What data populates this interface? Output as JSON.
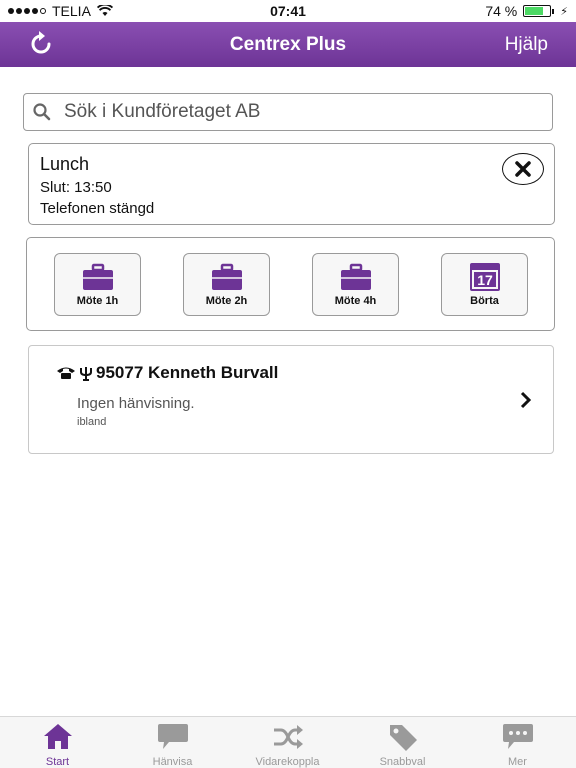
{
  "status_bar": {
    "carrier": "TELIA",
    "time": "07:41",
    "battery": "74 %",
    "battery_level": 0.74
  },
  "nav": {
    "title": "Centrex Plus",
    "help": "Hjälp"
  },
  "search": {
    "placeholder": "Sök i Kundföretaget AB"
  },
  "status": {
    "title": "Lunch",
    "end": "Slut: 13:50",
    "phone": "Telefonen stängd"
  },
  "quick": [
    {
      "label": "Möte 1h",
      "icon": "briefcase-icon"
    },
    {
      "label": "Möte 2h",
      "icon": "briefcase-icon"
    },
    {
      "label": "Möte 4h",
      "icon": "briefcase-icon"
    },
    {
      "label": "Börta",
      "icon": "calendar-icon",
      "day": "17"
    }
  ],
  "contact": {
    "name": "95077 Kenneth Burvall",
    "sub": "Ingen hänvisning.",
    "note": "ibland"
  },
  "tabs": [
    {
      "label": "Start",
      "icon": "home-icon"
    },
    {
      "label": "Hänvisa",
      "icon": "speech-bubble-icon"
    },
    {
      "label": "Vidarekoppla",
      "icon": "shuffle-icon"
    },
    {
      "label": "Snabbval",
      "icon": "tag-icon"
    },
    {
      "label": "Mer",
      "icon": "more-bubble-icon"
    }
  ],
  "colors": {
    "accent": "#6d3496",
    "tab_inactive": "#9a9a9a",
    "battery": "#4cd964"
  }
}
